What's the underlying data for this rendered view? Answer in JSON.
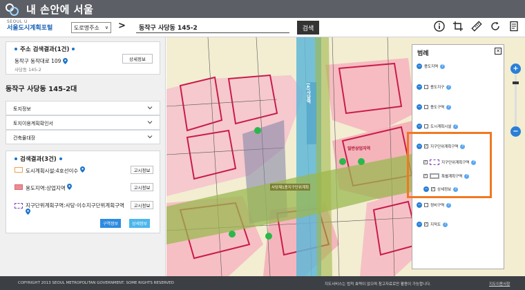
{
  "app": {
    "brand": "내 손안에 서울"
  },
  "portal": {
    "small": "SEOUL U",
    "name": "서울도시계획포털"
  },
  "search": {
    "type_label": "도로명주소",
    "query": "동작구 사당동 145-2",
    "button": "검색"
  },
  "tools": [
    {
      "icon": "info-icon"
    },
    {
      "icon": "crop-icon"
    },
    {
      "icon": "ruler-icon"
    },
    {
      "icon": "refresh-icon"
    },
    {
      "icon": "document-icon"
    }
  ],
  "address_result": {
    "title": "주소 검색결과(1건)",
    "road": "동작구 동작대로 109",
    "parcel": "사당동 145-2",
    "detail_button": "상세정보"
  },
  "place_title": "동작구 사당동 145-2대",
  "accordion": [
    "토지정보",
    "토지이용계획확인서",
    "건축물대장"
  ],
  "results": {
    "title": "검색결과(3건)",
    "items": [
      {
        "label": "도시계획시설:4호선이수",
        "button": "고시정보"
      },
      {
        "label": "용도지역:상업지역",
        "button": "고시정보"
      },
      {
        "label": "지구단위계획구역:사당·이수지구단위계획구역",
        "button": "고시정보"
      }
    ],
    "btn_area": "구역정보",
    "btn_detail": "상세정보"
  },
  "legend": {
    "title": "범례",
    "items": [
      {
        "label": "용도지역",
        "type": "toggle"
      },
      {
        "label": "용도지구",
        "type": "check"
      },
      {
        "label": "용도구역",
        "type": "check"
      },
      {
        "label": "도시계획시설",
        "type": "check"
      },
      {
        "label": "지구단위계획구역",
        "type": "check"
      },
      {
        "label": "지구단위계획구역",
        "type": "sub"
      },
      {
        "label": "특별계획구역",
        "type": "sub"
      },
      {
        "label": "상세정보",
        "type": "sub"
      },
      {
        "label": "정비구역",
        "type": "check"
      },
      {
        "label": "지적도",
        "type": "check"
      }
    ]
  },
  "map_labels": {
    "station": "(4)사당역",
    "zone": "일반상업지역",
    "area": "사당제1종지구단위계획"
  },
  "footer": {
    "copyright": "COPYRIGHT 2013 SEOUL METROPOLITAN GOVERNMENT. SOME RIGHTS RESERVED",
    "notice": "지도서비스는 법적 효력이 없으며 참고자료로만 활용이 가능합니다.",
    "link": "지도이용사항"
  },
  "colors": {
    "accent": "#1a73c9",
    "highlight": "#f07820",
    "commercial": "#f6b7bd",
    "green": "#9ab850",
    "water": "#5fb7d8"
  }
}
